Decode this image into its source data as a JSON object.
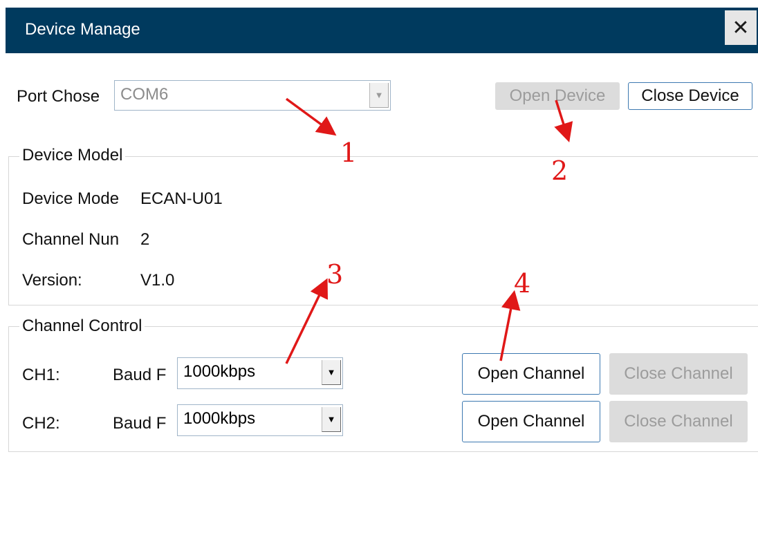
{
  "window": {
    "title": "Device Manage",
    "close_glyph": "✕"
  },
  "port": {
    "label": "Port Chose",
    "value": "COM6",
    "enabled": false
  },
  "toolbar": {
    "open_device": "Open Device",
    "close_device": "Close Device"
  },
  "device_model": {
    "title": "Device Model",
    "rows": [
      {
        "label": "Device Mode",
        "value": "ECAN-U01"
      },
      {
        "label": "Channel Nun",
        "value": "2"
      },
      {
        "label": "Version:",
        "value": "V1.0"
      }
    ]
  },
  "channel_control": {
    "title": "Channel Control",
    "channels": [
      {
        "name": "CH1:",
        "baud_label": "Baud F",
        "baud_value": "1000kbps",
        "open_label": "Open Channel",
        "close_label": "Close Channel"
      },
      {
        "name": "CH2:",
        "baud_label": "Baud F",
        "baud_value": "1000kbps",
        "open_label": "Open Channel",
        "close_label": "Close Channel"
      }
    ]
  },
  "annotations": [
    "1",
    "2",
    "3",
    "4"
  ],
  "colors": {
    "titlebar": "#003a5e",
    "annotation": "#e01818",
    "button_border": "#3c78b0"
  }
}
